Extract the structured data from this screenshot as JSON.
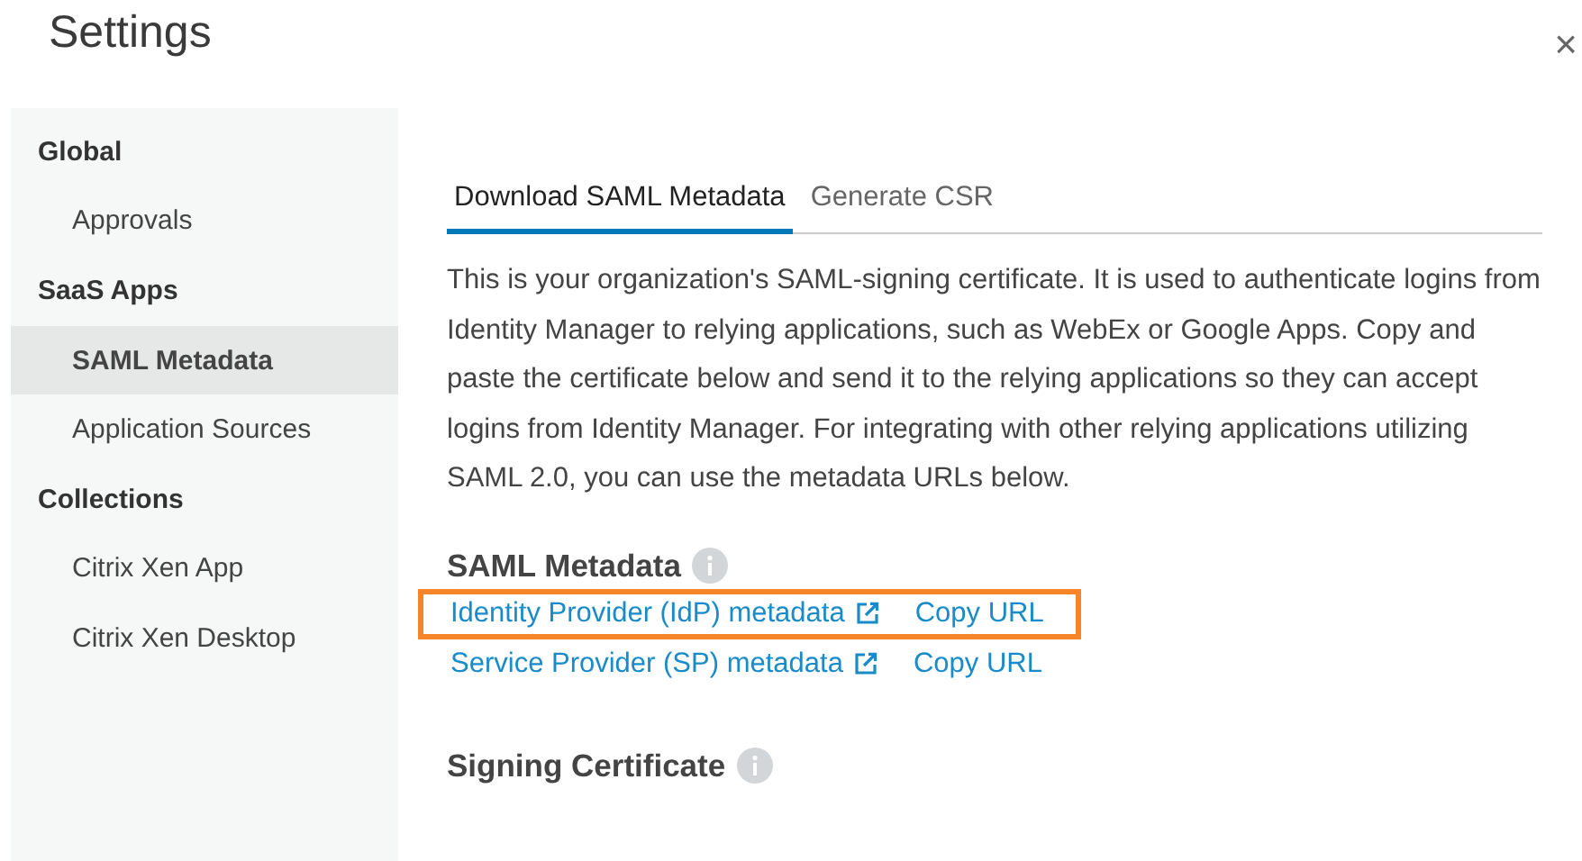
{
  "window": {
    "title": "Settings",
    "close": "×"
  },
  "sidebar": {
    "items": [
      {
        "kind": "heading",
        "label": "Global",
        "selected": false
      },
      {
        "kind": "item",
        "label": "Approvals",
        "selected": false
      },
      {
        "kind": "heading",
        "label": "SaaS Apps",
        "selected": false
      },
      {
        "kind": "item",
        "label": "SAML Metadata",
        "selected": true
      },
      {
        "kind": "item",
        "label": "Application Sources",
        "selected": false
      },
      {
        "kind": "heading",
        "label": "Collections",
        "selected": false
      },
      {
        "kind": "item",
        "label": "Citrix Xen App",
        "selected": false
      },
      {
        "kind": "item",
        "label": "Citrix Xen Desktop",
        "selected": false
      }
    ]
  },
  "tabs": [
    {
      "label": "Download SAML Metadata",
      "selected": true
    },
    {
      "label": "Generate CSR",
      "selected": false
    }
  ],
  "description": "This is your organization's SAML-signing certificate. It is used to authenticate logins from Identity Manager to relying applications, such as WebEx or Google Apps. Copy and paste the certificate below and send it to the relying applications so they can accept logins from Identity Manager. For integrating with other relying applications utilizing SAML 2.0, you can use the metadata URLs below.",
  "saml_metadata": {
    "heading": "SAML Metadata",
    "links": [
      {
        "label": "Identity Provider (IdP) metadata",
        "copy": "Copy URL",
        "highlighted": true
      },
      {
        "label": "Service Provider (SP) metadata",
        "copy": "Copy URL",
        "highlighted": false
      }
    ]
  },
  "signing_certificate": {
    "heading": "Signing Certificate"
  }
}
